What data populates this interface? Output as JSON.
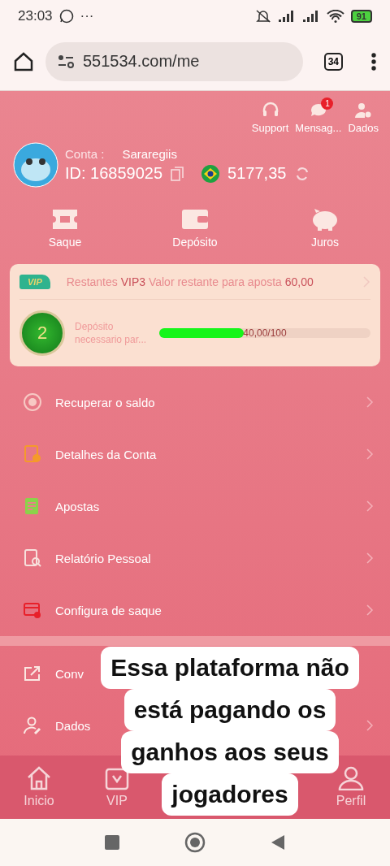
{
  "status_bar": {
    "time": "23:03",
    "more": "···",
    "battery": "91"
  },
  "browser": {
    "url": "551534.com/me",
    "tab_count": "34"
  },
  "header_actions": [
    {
      "kind": "support",
      "label": "Support"
    },
    {
      "kind": "messages",
      "label": "Mensag...",
      "badge": "1"
    },
    {
      "kind": "profile",
      "label": "Dados"
    }
  ],
  "account": {
    "label": "Conta :",
    "name": "Sararegiis",
    "id": "ID: 16859025",
    "balance": "5177,35"
  },
  "quick_actions": [
    {
      "kind": "withdraw",
      "label": "Saque"
    },
    {
      "kind": "deposit",
      "label": "Depósito"
    },
    {
      "kind": "interest",
      "label": "Juros"
    }
  ],
  "vip": {
    "badge": "VIP",
    "remaining": "Restantes **VIP3**  Valor restante para aposta **60,00**",
    "level_badge": "2",
    "requirement": "Depósito necessario par...",
    "level": 0.4,
    "reading": "40,00/100"
  },
  "menu": [
    {
      "kind": "recover",
      "label": "Recuperar o saldo",
      "arrow": true
    },
    {
      "kind": "details",
      "label": "Detalhes da Conta",
      "arrow": true
    },
    {
      "kind": "bets",
      "label": "Apostas",
      "arrow": true
    },
    {
      "kind": "report",
      "label": "Relatório Pessoal",
      "arrow": true
    },
    {
      "kind": "withdraw-config",
      "label": "Configura de saque",
      "arrow": true
    }
  ],
  "menu_2": [
    {
      "kind": "share",
      "label": "Conv",
      "arrow": false
    },
    {
      "kind": "data",
      "label": "Dados",
      "arrow": true
    }
  ],
  "bottom_nav": [
    {
      "kind": "home",
      "label": "Inicio"
    },
    {
      "kind": "vip",
      "label": "VIP"
    },
    {
      "kind": "profile",
      "label": "Perfil"
    }
  ],
  "caption": [
    "Essa plataforma não",
    "está pagando os",
    "ganhos aos seus",
    "jogadores"
  ]
}
